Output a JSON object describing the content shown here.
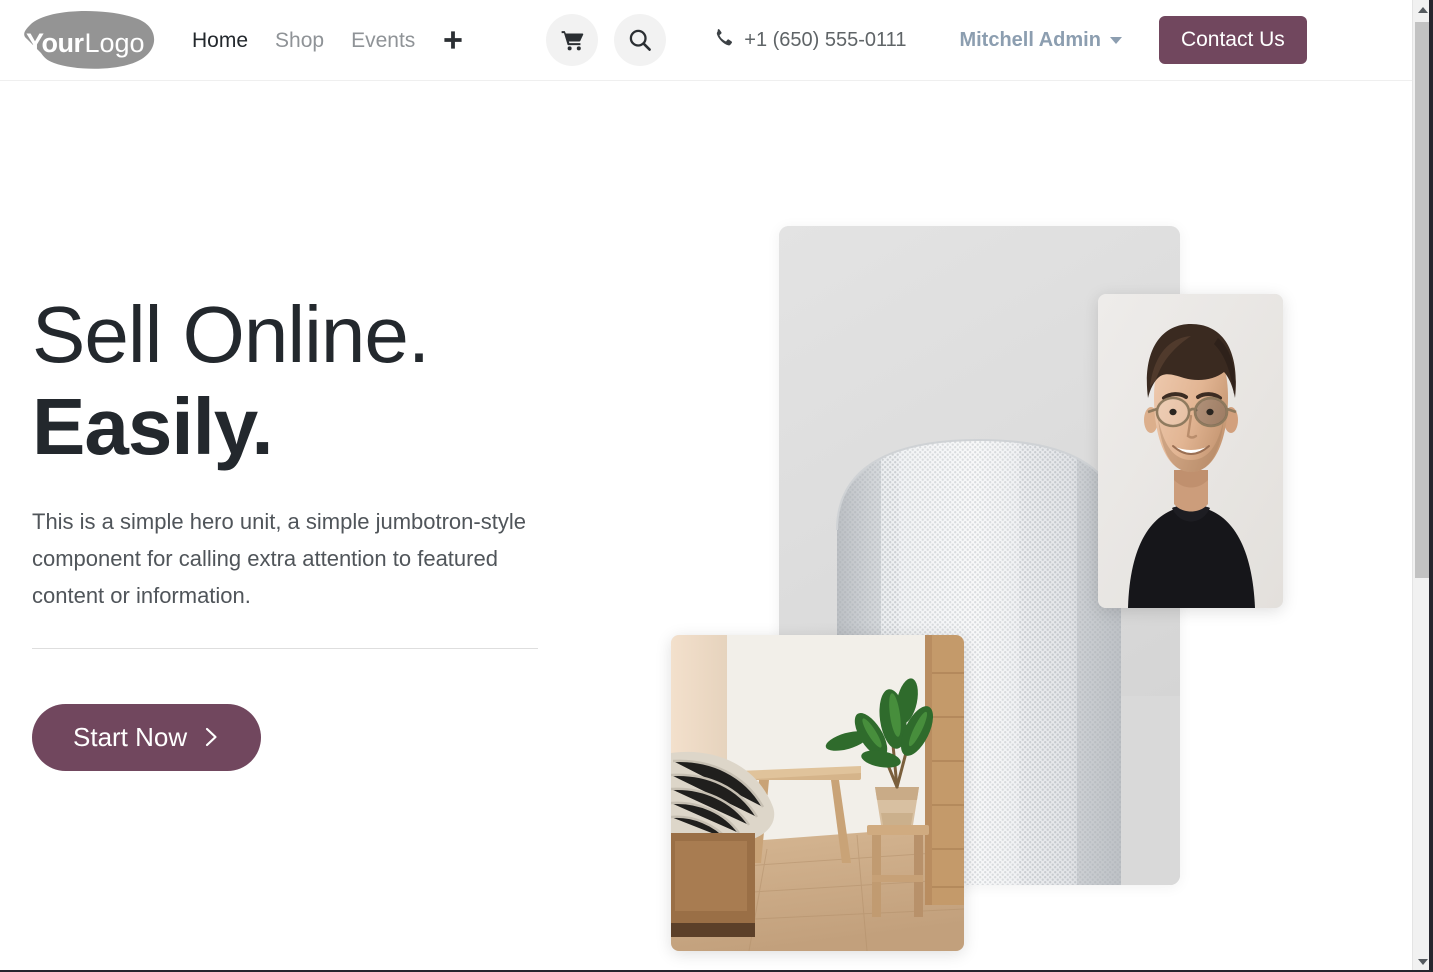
{
  "header": {
    "logo": {
      "part1": "Your",
      "part2": "Logo",
      "icon": "blob-logo-shape"
    },
    "nav": [
      {
        "label": "Home",
        "active": true
      },
      {
        "label": "Shop",
        "active": false
      },
      {
        "label": "Events",
        "active": false
      }
    ],
    "add_page_icon": "plus-icon",
    "cart_icon": "shopping-cart-icon",
    "search_icon": "search-icon",
    "phone_icon": "phone-icon",
    "phone_number": "+1 (650) 555-0111",
    "user_name": "Mitchell Admin",
    "user_caret_icon": "chevron-down-icon",
    "contact_label": "Contact Us"
  },
  "hero": {
    "title_line1": "Sell Online.",
    "title_line2": "Easily.",
    "lead": "This is a simple hero unit, a simple jumbotron-style component for calling extra attention to featured content or information.",
    "cta_label": "Start Now",
    "cta_icon": "chevron-right-icon",
    "images": [
      {
        "name": "smart-speaker-photo",
        "alt": "White mesh smart speaker on light background"
      },
      {
        "name": "portrait-photo",
        "alt": "Smiling man with glasses in a black t-shirt"
      },
      {
        "name": "bedroom-photo",
        "alt": "Bedroom with wooden bench, potted plant on stool and wood floor"
      }
    ]
  },
  "colors": {
    "brand_plum": "#71475e",
    "heading": "#23282d",
    "body_text": "#50555a",
    "nav_inactive": "#8f9397",
    "user_name": "#8c9eb0",
    "icon_circle_bg": "#f2f2f2"
  },
  "scrollbar": {
    "up_icon": "scroll-up-arrow-icon",
    "down_icon": "scroll-down-arrow-icon",
    "thumb": "scroll-thumb"
  }
}
